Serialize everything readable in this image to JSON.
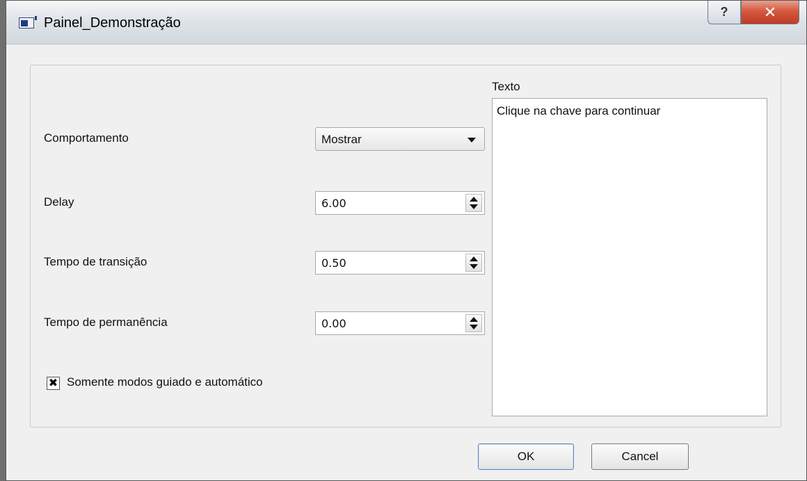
{
  "window": {
    "title": "Painel_Demonstração",
    "help_glyph": "?",
    "close_glyph": "✕"
  },
  "form": {
    "behavior_label": "Comportamento",
    "behavior_value": "Mostrar",
    "delay_label": "Delay",
    "delay_value": "6.00",
    "transition_label": "Tempo de transição",
    "transition_value": "0.50",
    "stay_label": "Tempo de permanência",
    "stay_value": "0.00",
    "checkbox_label": "Somente modos guiado e automático",
    "checkbox_checked": true,
    "checkbox_glyph": "✖",
    "text_label": "Texto",
    "text_value": "Clique na chave para continuar"
  },
  "buttons": {
    "ok": "OK",
    "cancel": "Cancel"
  }
}
